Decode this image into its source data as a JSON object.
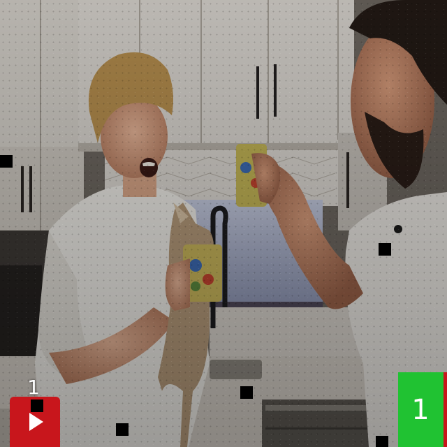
{
  "video": {
    "left_counter": "1",
    "score_value": "1",
    "score_caption": ""
  },
  "icons": {
    "play": "play-icon"
  },
  "colors": {
    "play_button": "#c8161c",
    "score_box": "#20c232",
    "score_edge": "#c8161c",
    "overlay_text": "#ffffff"
  }
}
